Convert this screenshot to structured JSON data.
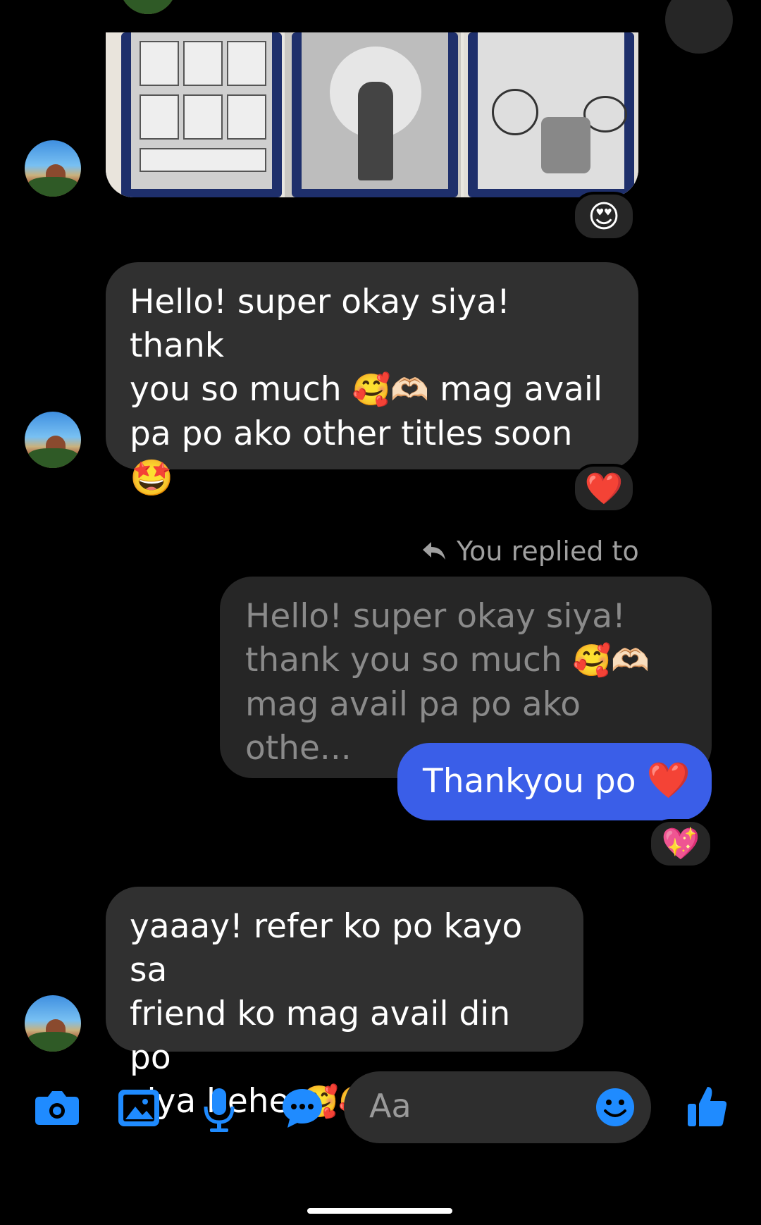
{
  "messages": {
    "msg1": {
      "line1": "Hello! super okay siya! thank",
      "line2_a": "you so much ",
      "line2_emoji": "🥰🫶🏻",
      "line2_b": " mag avail",
      "line3": "pa po ako other titles soon",
      "line4_emoji": "🤩",
      "reaction": "❤️"
    },
    "photo_reaction": "😍",
    "reply_label": "You replied to",
    "quote": {
      "line1": "Hello! super okay siya!",
      "line2_a": "thank you so much ",
      "line2_emoji": "🥰🫶🏻",
      "line3": "mag avail pa po ako othe..."
    },
    "outgoing": {
      "text": "Thankyou po ",
      "emoji": "❤️",
      "reaction": "💖"
    },
    "msg3": {
      "line1": "yaaay! refer ko po kayo sa",
      "line2": "friend ko mag avail din po",
      "line3_a": "siya hehe ",
      "line3_emoji": "🥰🥰"
    }
  },
  "composer": {
    "placeholder": "Aa",
    "icons": [
      "camera-icon",
      "image-icon",
      "microphone-icon",
      "chat-bubble-icon",
      "emoji-icon",
      "thumbs-up-icon"
    ]
  },
  "colors": {
    "background": "#000000",
    "incoming_bubble": "#303030",
    "outgoing_bubble": "#3a5ee8",
    "accent": "#1f8bff"
  }
}
